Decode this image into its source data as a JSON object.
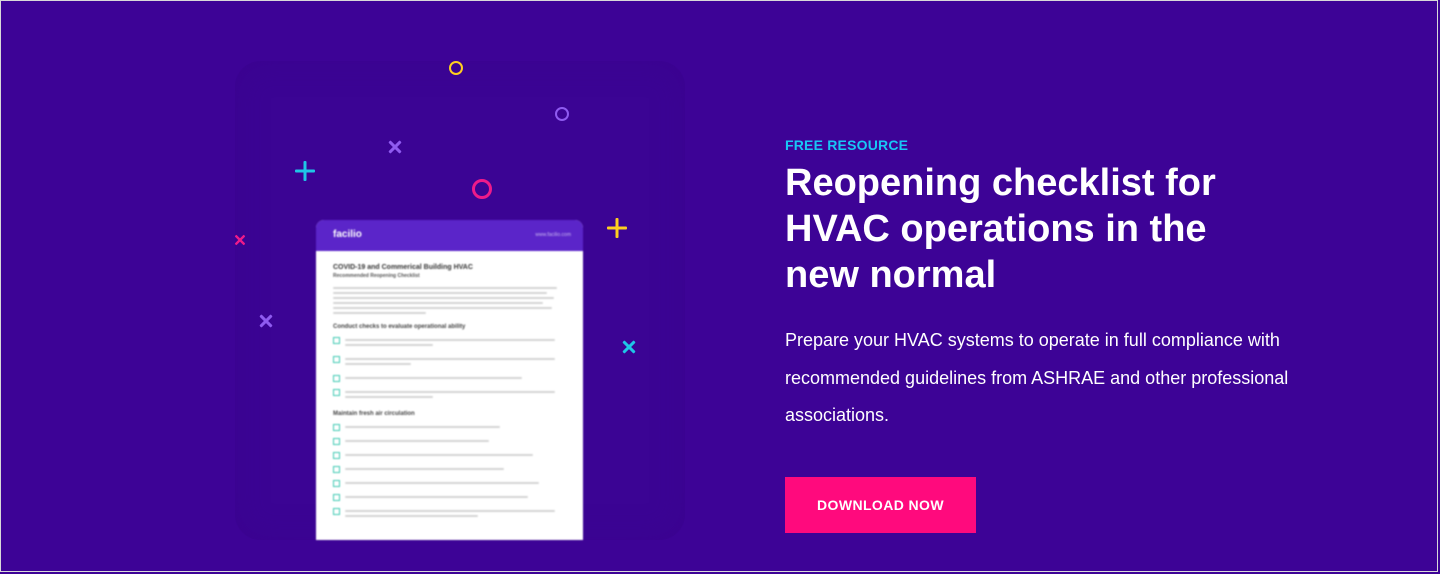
{
  "hero": {
    "eyebrow": "FREE RESOURCE",
    "headline": "Reopening checklist for HVAC operations in the new normal",
    "description": "Prepare your HVAC systems to operate in full compliance with recommended guidelines from ASHRAE and other professional associations.",
    "cta_label": "DOWNLOAD NOW"
  },
  "document_preview": {
    "brand": "facilio",
    "url": "www.facilio.com",
    "title": "COVID-19 and Commerical Building HVAC",
    "subtitle": "Recommended Reopening Checklist",
    "section_1": "Conduct checks to evaluate operational ability",
    "section_2": "Maintain fresh air circulation"
  },
  "colors": {
    "background": "#3d0396",
    "accent_cyan": "#18c7f5",
    "cta_pink": "#ff0a7d",
    "doc_header": "#5b25c9"
  },
  "decorations": {
    "icons": [
      "circle-yellow",
      "circle-violet",
      "circle-pink",
      "plus-cyan",
      "plus-yellow",
      "cross-violet",
      "cross-pink",
      "cross-cyan"
    ]
  }
}
